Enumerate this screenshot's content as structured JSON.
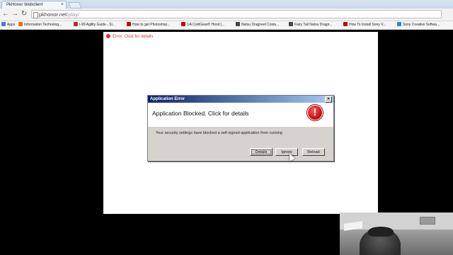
{
  "browser": {
    "tab_title": "PkHonor Webclient",
    "tab_close": "×",
    "url_host": "pkhonor.net",
    "url_path": "/play/",
    "bookmarks": [
      {
        "label": "Apps",
        "icon": "apps-grid-icon",
        "color": "#4a7bd1"
      },
      {
        "label": "Information Technolog...",
        "icon": "bookmark-site-icon",
        "color": "#e07020"
      },
      {
        "label": "I-99 Agility Guide - Si...",
        "icon": "bookmark-site-icon",
        "color": "#b03030"
      },
      {
        "label": "How to get Photoshop...",
        "icon": "youtube-icon",
        "color": "#cc0000"
      },
      {
        "label": "UA ColdGear® Hood |...",
        "icon": "bookmark-site-icon",
        "color": "#cc0000"
      },
      {
        "label": "Natsu Dragneel Costu...",
        "icon": "bookmark-site-icon",
        "color": "#444444"
      },
      {
        "label": "Fairy Tail Natsu Dragn...",
        "icon": "bookmark-site-icon",
        "color": "#444444"
      },
      {
        "label": "How To Install Sony V...",
        "icon": "youtube-icon",
        "color": "#cc0000"
      },
      {
        "label": "Sony Creative Softwa...",
        "icon": "bookmark-site-icon",
        "color": "#2a8ad6"
      }
    ]
  },
  "page": {
    "error_strip": "Error: Click for details"
  },
  "dialog": {
    "title": "Application Error",
    "close": "×",
    "heading": "Application Blocked. Click for details",
    "message": "Your security settings have blocked a self-signed application from running",
    "buttons": {
      "details": "Details",
      "ignore": "Ignore",
      "reload": "Reload"
    },
    "icon": "error-exclamation-icon"
  }
}
